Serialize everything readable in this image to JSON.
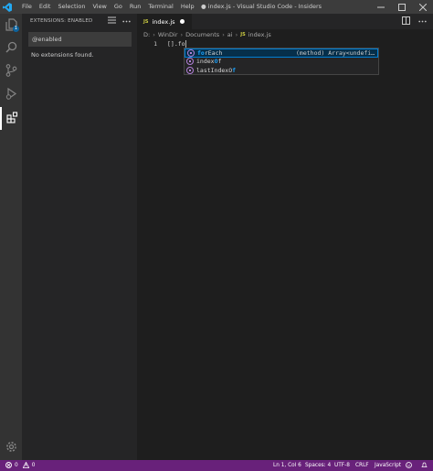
{
  "titlebar": {
    "menu": [
      "File",
      "Edit",
      "Selection",
      "View",
      "Go",
      "Run",
      "Terminal",
      "Help"
    ],
    "title": "● index.js - Visual Studio Code - Insiders"
  },
  "activitybar": {
    "items": [
      {
        "icon": "files-icon",
        "badge": "1"
      },
      {
        "icon": "search-icon"
      },
      {
        "icon": "source-control-icon"
      },
      {
        "icon": "run-debug-icon"
      },
      {
        "icon": "extensions-icon",
        "active": true
      },
      {
        "icon": "gear-icon"
      }
    ]
  },
  "sidebar": {
    "title": "EXTENSIONS: ENABLED",
    "search_value": "@enabled",
    "empty_message": "No extensions found."
  },
  "editor": {
    "tab_label": "index.js",
    "tab_badge": "JS",
    "breadcrumb": [
      "D:",
      "WinDir",
      "Documents",
      "ai",
      "index.js"
    ],
    "line_number": "1",
    "code": "[].fo"
  },
  "suggest": {
    "items": [
      {
        "label": "forEach",
        "match": "fo",
        "rest": "rEach",
        "detail": "(method) Array<undefi…",
        "selected": true
      },
      {
        "label": "indexOf",
        "pre": "index",
        "match": "O",
        "rest": "f"
      },
      {
        "label": "lastIndexOf",
        "pre": "lastIndexO",
        "match": "f",
        "rest": ""
      }
    ]
  },
  "statusbar": {
    "errors": "0",
    "warnings": "0",
    "position": "Ln 1, Col 6",
    "spaces": "Spaces: 4",
    "encoding": "UTF-8",
    "eol": "CRLF",
    "language": "JavaScript"
  },
  "colors": {
    "statusbar": "#68217a",
    "accent": "#007fd4",
    "titlebar": "#3c3c3c"
  }
}
